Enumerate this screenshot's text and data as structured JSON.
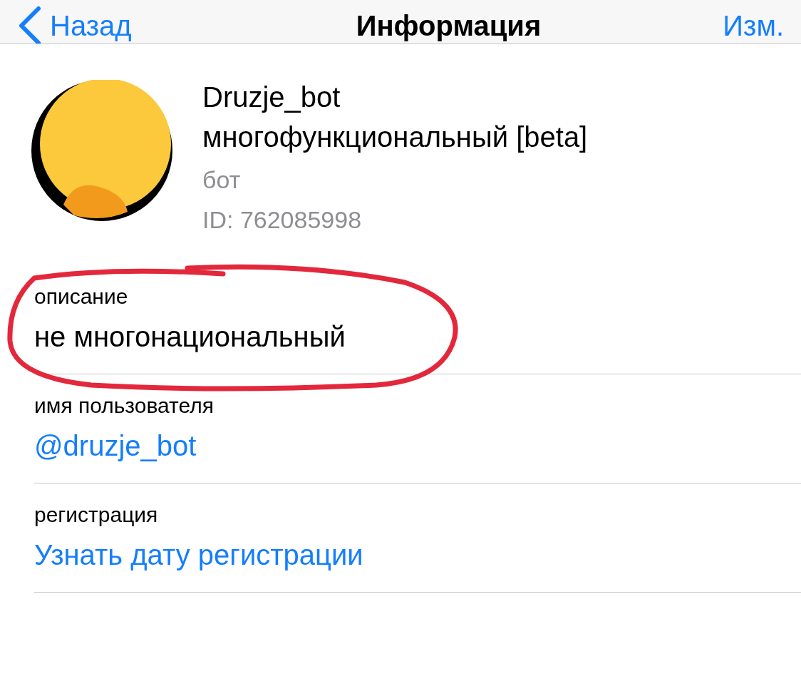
{
  "nav": {
    "back": "Назад",
    "title": "Информация",
    "edit": "Изм."
  },
  "profile": {
    "name": "Druzje_bot многофункциональный [beta]",
    "type": "бот",
    "id": "ID: 762085998"
  },
  "fields": [
    {
      "label": "описание",
      "value": "не многонациональный",
      "kind": "text"
    },
    {
      "label": "имя пользователя",
      "value": "@druzje_bot",
      "kind": "link"
    },
    {
      "label": "регистрация",
      "value": "Узнать дату регистрации",
      "kind": "link"
    }
  ]
}
